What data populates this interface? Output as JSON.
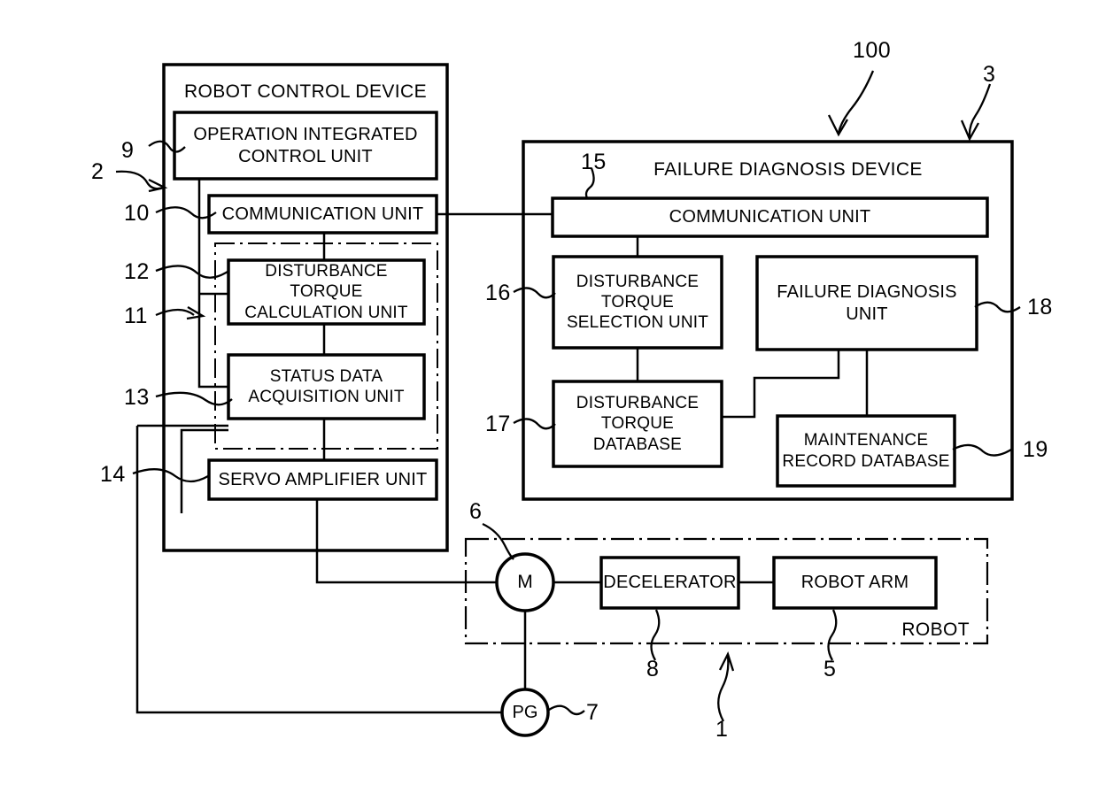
{
  "figure": {
    "type": "patent-block-diagram",
    "system_ref": "100",
    "background": "#ffffff",
    "line_color": "#000000"
  },
  "robot_control_device": {
    "title": "ROBOT CONTROL DEVICE",
    "ref": "2",
    "blocks": [
      {
        "id": "operation_integrated_control_unit",
        "label": "OPERATION INTEGRATED\nCONTROL UNIT",
        "ref": "9"
      },
      {
        "id": "communication_unit",
        "label": "COMMUNICATION UNIT",
        "ref": "10"
      },
      {
        "id": "disturbance_torque_calculation_unit",
        "label": "DISTURBANCE TORQUE\nCALCULATION UNIT",
        "ref": "12"
      },
      {
        "id": "status_data_acquisition_unit",
        "label": "STATUS DATA\nACQUISITION UNIT",
        "ref": "13"
      },
      {
        "id": "servo_amplifier_unit",
        "label": "SERVO AMPLIFIER UNIT",
        "ref": "14"
      }
    ],
    "dash_dot_group_ref": "11"
  },
  "failure_diagnosis_device": {
    "title": "FAILURE DIAGNOSIS DEVICE",
    "ref": "3",
    "blocks": [
      {
        "id": "communication_unit",
        "label": "COMMUNICATION UNIT",
        "ref": "15"
      },
      {
        "id": "disturbance_torque_selection_unit",
        "label": "DISTURBANCE\nTORQUE\nSELECTION UNIT",
        "ref": "16"
      },
      {
        "id": "disturbance_torque_database",
        "label": "DISTURBANCE\nTORQUE\nDATABASE",
        "ref": "17"
      },
      {
        "id": "failure_diagnosis_unit",
        "label": "FAILURE DIAGNOSIS\nUNIT",
        "ref": "18"
      },
      {
        "id": "maintenance_record_database",
        "label": "MAINTENANCE\nRECORD DATABASE",
        "ref": "19"
      }
    ]
  },
  "robot": {
    "title": "ROBOT",
    "ref": "1",
    "blocks": [
      {
        "id": "motor",
        "label": "M",
        "ref": "6",
        "shape": "circle"
      },
      {
        "id": "decelerator",
        "label": "DECELERATOR",
        "ref": "8",
        "shape": "rect"
      },
      {
        "id": "robot_arm",
        "label": "ROBOT ARM",
        "ref": "5",
        "shape": "rect"
      },
      {
        "id": "pulse_generator",
        "label": "PG",
        "ref": "7",
        "shape": "circle"
      }
    ]
  },
  "reference_numbers": [
    "100",
    "3",
    "2",
    "9",
    "10",
    "12",
    "11",
    "13",
    "14",
    "15",
    "16",
    "17",
    "18",
    "19",
    "6",
    "8",
    "1",
    "5",
    "7"
  ]
}
